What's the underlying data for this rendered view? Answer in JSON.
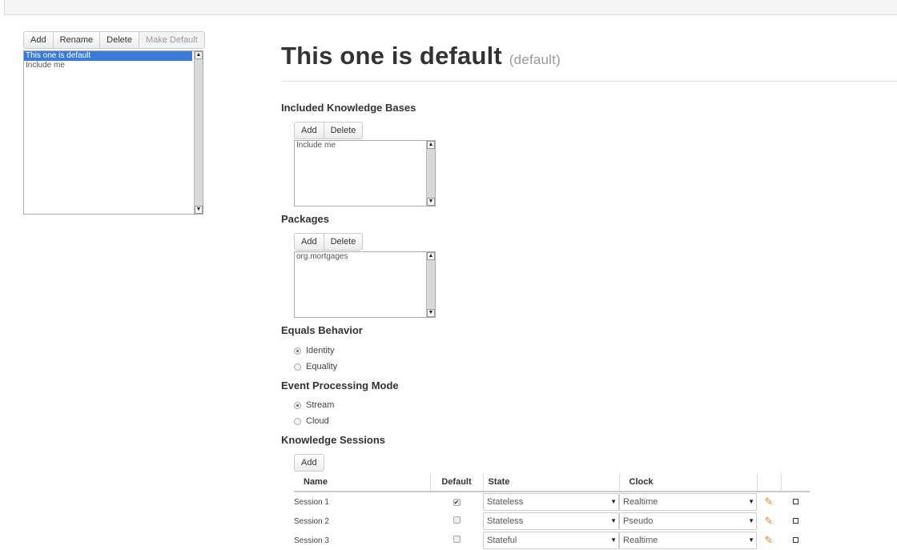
{
  "kbase_toolbar": {
    "add": "Add",
    "rename": "Rename",
    "delete": "Delete",
    "make_default": "Make Default"
  },
  "kbase_list": [
    "This one is default",
    "Include me"
  ],
  "kbase_selected_index": 0,
  "title": {
    "name": "This one is default",
    "suffix": "(default)"
  },
  "included": {
    "heading": "Included Knowledge Bases",
    "add": "Add",
    "delete": "Delete",
    "items": [
      "Include me"
    ]
  },
  "packages": {
    "heading": "Packages",
    "add": "Add",
    "delete": "Delete",
    "items": [
      "org.mortgages"
    ]
  },
  "equals": {
    "heading": "Equals Behavior",
    "options": [
      "Identity",
      "Equality"
    ],
    "selected": "Identity"
  },
  "event_mode": {
    "heading": "Event Processing Mode",
    "options": [
      "Stream",
      "Cloud"
    ],
    "selected": "Stream"
  },
  "sessions": {
    "heading": "Knowledge Sessions",
    "add": "Add",
    "columns": [
      "Name",
      "Default",
      "State",
      "Clock"
    ],
    "rows": [
      {
        "name": "Session 1",
        "default": true,
        "state": "Stateless",
        "clock": "Realtime"
      },
      {
        "name": "Session 2",
        "default": false,
        "state": "Stateless",
        "clock": "Pseudo"
      },
      {
        "name": "Session 3",
        "default": false,
        "state": "Stateful",
        "clock": "Realtime"
      }
    ]
  },
  "icons": {
    "edit": "pencil-icon",
    "remove": "small-square-icon",
    "check": "checkmark-icon"
  },
  "colors": {
    "selection": "#3a7bd5",
    "pencil": "#d68b20"
  }
}
